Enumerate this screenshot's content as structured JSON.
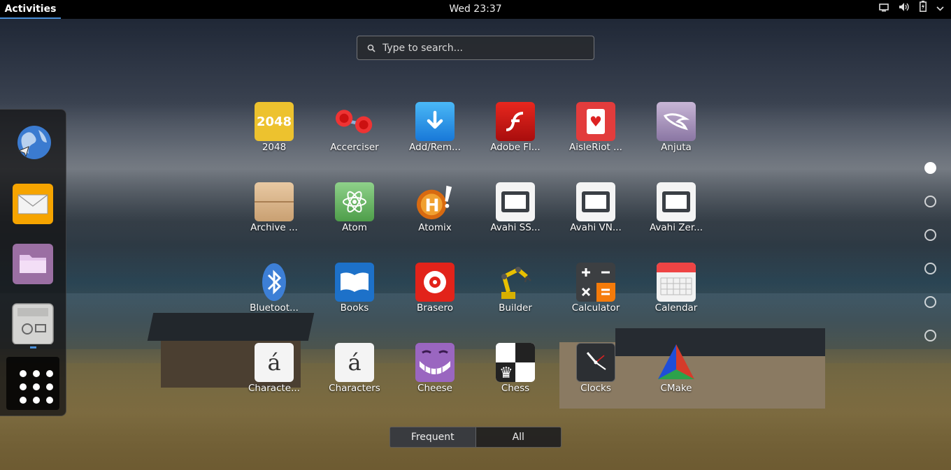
{
  "topbar": {
    "activities_label": "Activities",
    "clock": "Wed 23:37",
    "tray_icons": [
      "screen-icon",
      "volume-icon",
      "battery-icon",
      "chevron-down-icon"
    ]
  },
  "search": {
    "placeholder": "Type to search..."
  },
  "dash": {
    "items": [
      "web-browser-icon",
      "mail-icon",
      "files-icon",
      "software-icon",
      "show-apps-icon"
    ]
  },
  "apps": [
    {
      "label": "2048",
      "icon_text": "2048"
    },
    {
      "label": "Accerciser"
    },
    {
      "label": "Add/Rem..."
    },
    {
      "label": "Adobe Fl..."
    },
    {
      "label": "AisleRiot ..."
    },
    {
      "label": "Anjuta"
    },
    {
      "label": "Archive ..."
    },
    {
      "label": "Atom"
    },
    {
      "label": "Atomix"
    },
    {
      "label": "Avahi SS..."
    },
    {
      "label": "Avahi VN..."
    },
    {
      "label": "Avahi Zer..."
    },
    {
      "label": "Bluetoot..."
    },
    {
      "label": "Books"
    },
    {
      "label": "Brasero"
    },
    {
      "label": "Builder"
    },
    {
      "label": "Calculator"
    },
    {
      "label": "Calendar"
    },
    {
      "label": "Characte...",
      "icon_text": "á"
    },
    {
      "label": "Characters",
      "icon_text": "á"
    },
    {
      "label": "Cheese"
    },
    {
      "label": "Chess"
    },
    {
      "label": "Clocks"
    },
    {
      "label": "CMake"
    }
  ],
  "pager": {
    "current_page": 1,
    "total_pages": 6
  },
  "view_switch": {
    "frequent_label": "Frequent",
    "all_label": "All",
    "selected": "All"
  },
  "colors": {
    "accent": "#4a90d9",
    "topbar": "#000000"
  }
}
